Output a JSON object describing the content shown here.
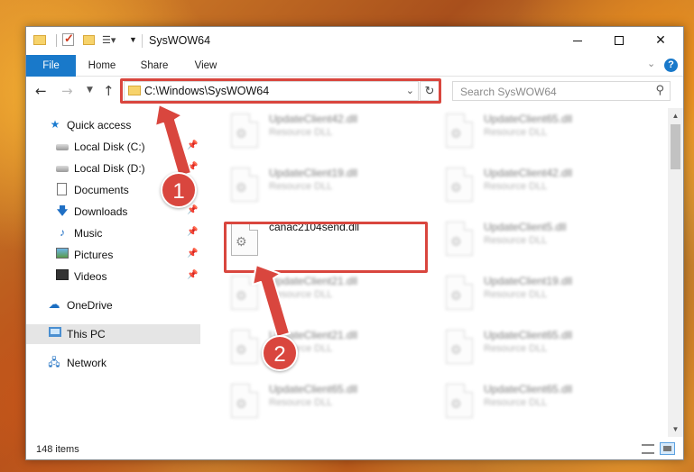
{
  "window": {
    "title": "SysWOW64",
    "tabs": {
      "file": "File",
      "home": "Home",
      "share": "Share",
      "view": "View"
    },
    "help": "?"
  },
  "nav": {
    "address": "C:\\Windows\\SysWOW64",
    "search_placeholder": "Search SysWOW64"
  },
  "sidebar": {
    "items": [
      {
        "label": "Quick access",
        "icon": "star-icon",
        "pinned": false
      },
      {
        "label": "Local Disk (C:)",
        "icon": "drive-icon",
        "pinned": true
      },
      {
        "label": "Local Disk (D:)",
        "icon": "drive-icon",
        "pinned": true
      },
      {
        "label": "Documents",
        "icon": "documents-icon",
        "pinned": false
      },
      {
        "label": "Downloads",
        "icon": "downloads-icon",
        "pinned": true
      },
      {
        "label": "Music",
        "icon": "music-icon",
        "pinned": true
      },
      {
        "label": "Pictures",
        "icon": "pictures-icon",
        "pinned": true
      },
      {
        "label": "Videos",
        "icon": "videos-icon",
        "pinned": true
      },
      {
        "label": "OneDrive",
        "icon": "cloud-icon",
        "pinned": false
      },
      {
        "label": "This PC",
        "icon": "pc-icon",
        "pinned": false,
        "selected": true
      },
      {
        "label": "Network",
        "icon": "network-icon",
        "pinned": false
      }
    ]
  },
  "files": [
    {
      "name": "UpdateClient42.dll",
      "type": "Resource DLL"
    },
    {
      "name": "UpdateClient65.dll",
      "type": "Resource DLL"
    },
    {
      "name": "UpdateClient19.dll",
      "type": "Resource DLL"
    },
    {
      "name": "UpdateClient42.dll",
      "type": "Resource DLL"
    },
    {
      "name": "canac2104send.dll",
      "type": ""
    },
    {
      "name": "UpdateClient5.dll",
      "type": "Resource DLL"
    },
    {
      "name": "UpdateClient21.dll",
      "type": "Resource DLL"
    },
    {
      "name": "UpdateClient19.dll",
      "type": "Resource DLL"
    },
    {
      "name": "UpdateClient21.dll",
      "type": "Resource DLL"
    },
    {
      "name": "UpdateClient65.dll",
      "type": "Resource DLL"
    },
    {
      "name": "UpdateClient65.dll",
      "type": "Resource DLL"
    },
    {
      "name": "UpdateClient65.dll",
      "type": "Resource DLL"
    }
  ],
  "status": {
    "items": "148 items"
  },
  "callouts": {
    "one": "1",
    "two": "2"
  },
  "colors": {
    "accent": "#1979ca",
    "highlight": "#d9463e"
  }
}
